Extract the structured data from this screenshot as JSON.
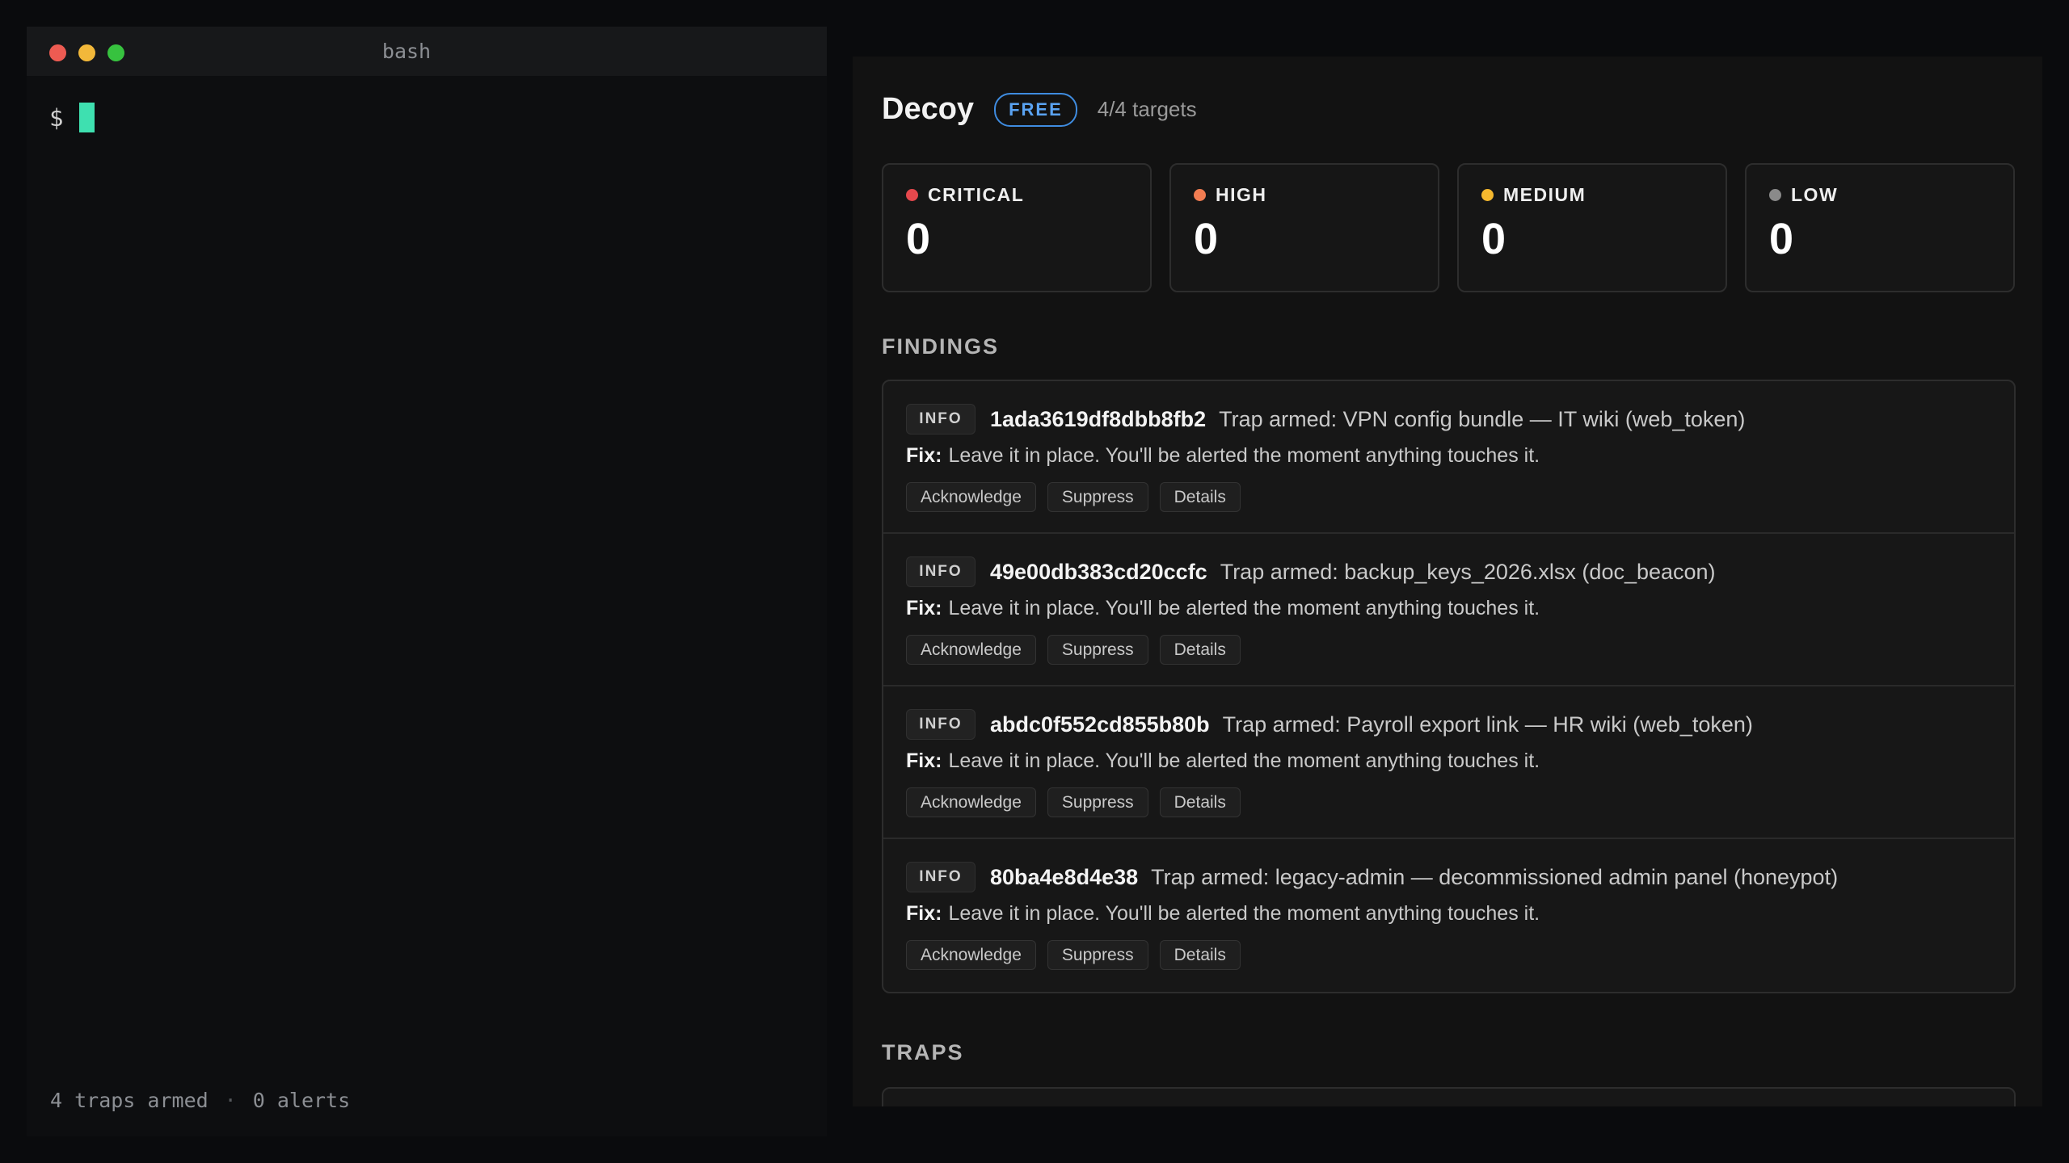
{
  "terminal": {
    "title": "bash",
    "prompt": "$",
    "status": {
      "traps": "4 traps armed",
      "separator": "·",
      "alerts": "0 alerts"
    }
  },
  "dashboard": {
    "title": "Decoy",
    "plan_badge": "FREE",
    "targets": "4/4 targets",
    "severity": [
      {
        "label": "CRITICAL",
        "count": "0",
        "color": "#e5484d"
      },
      {
        "label": "HIGH",
        "count": "0",
        "color": "#f27d52"
      },
      {
        "label": "MEDIUM",
        "count": "0",
        "color": "#f5b82e"
      },
      {
        "label": "LOW",
        "count": "0",
        "color": "#8a8a8a"
      }
    ],
    "findings_heading": "FINDINGS",
    "fix_label": "Fix:",
    "actions": {
      "acknowledge": "Acknowledge",
      "suppress": "Suppress",
      "details": "Details"
    },
    "findings": [
      {
        "level": "INFO",
        "id": "1ada3619df8dbb8fb2",
        "description": "Trap armed: VPN config bundle — IT wiki (web_token)",
        "fix": "Leave it in place. You'll be alerted the moment anything touches it."
      },
      {
        "level": "INFO",
        "id": "49e00db383cd20ccfc",
        "description": "Trap armed: backup_keys_2026.xlsx (doc_beacon)",
        "fix": "Leave it in place. You'll be alerted the moment anything touches it."
      },
      {
        "level": "INFO",
        "id": "abdc0f552cd855b80b",
        "description": "Trap armed: Payroll export link — HR wiki (web_token)",
        "fix": "Leave it in place. You'll be alerted the moment anything touches it."
      },
      {
        "level": "INFO",
        "id": "80ba4e8d4e38",
        "description": "Trap armed: legacy-admin — decommissioned admin panel (honeypot)",
        "fix": "Leave it in place. You'll be alerted the moment anything touches it."
      }
    ],
    "traps_heading": "TRAPS"
  }
}
